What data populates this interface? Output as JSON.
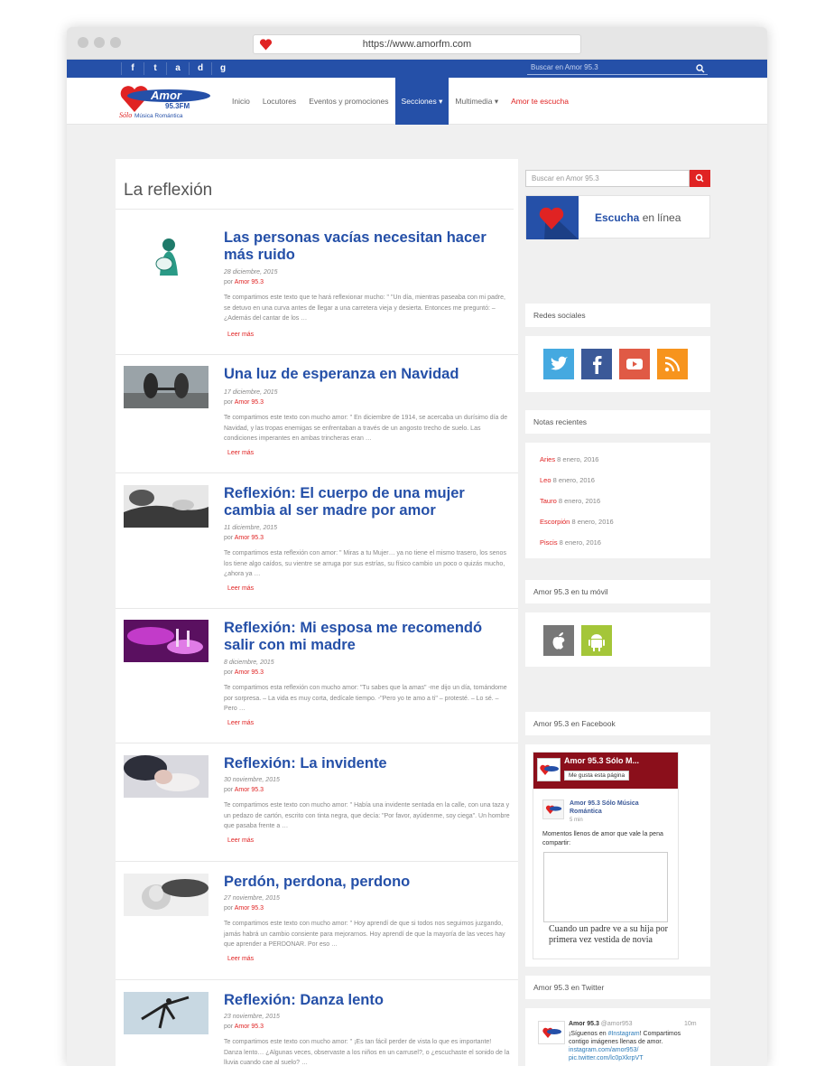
{
  "browser": {
    "url": "https://www.amorfm.com"
  },
  "topbar": {
    "social": [
      "f",
      "t",
      "a",
      "d",
      "g"
    ],
    "search_placeholder": "Buscar en Amor 95.3"
  },
  "header": {
    "logo_text": "Amor",
    "logo_freq": "95.3FM",
    "logo_tagline_1": "Sólo",
    "logo_tagline_2": "Música Romántica",
    "nav": [
      {
        "label": "Inicio"
      },
      {
        "label": "Locutores"
      },
      {
        "label": "Eventos y promociones"
      },
      {
        "label": "Secciones ▾"
      },
      {
        "label": "Multimedia ▾"
      },
      {
        "label": "Amor te escucha"
      }
    ]
  },
  "main": {
    "title": "La reflexión",
    "read_more": "Leer más",
    "by_label": "por",
    "posts": [
      {
        "title": "Las personas vacías necesitan hacer más ruido",
        "date": "28 diciembre, 2015",
        "author": "Amor 95.3",
        "excerpt": "Te compartimos este texto que te hará reflexionar mucho: \" \"Un día, mientras paseaba con mi padre, se detuvo en una curva antes de llegar a una carretera vieja y desierta. Entonces me preguntó: – ¿Además del cantar de los …"
      },
      {
        "title": "Una luz de esperanza en Navidad",
        "date": "17 diciembre, 2015",
        "author": "Amor 95.3",
        "excerpt": "Te compartimos este texto con mucho amor: \" En diciembre de 1914, se acercaba un durísimo día de Navidad, y las tropas enemigas se enfrentaban a través de un angosto trecho de suelo. Las condiciones imperantes en ambas trincheras eran …"
      },
      {
        "title": "Reflexión: El cuerpo de una mujer cambia al ser madre por amor",
        "date": "11 diciembre, 2015",
        "author": "Amor 95.3",
        "excerpt": "Te compartimos esta reflexión con amor: \" Miras a tu Mujer… ya no tiene el mismo trasero, los senos los tiene algo caídos, su vientre se arruga por sus estrías, su físico cambio un poco o quizás mucho, ¿ahora ya …"
      },
      {
        "title": "Reflexión: Mi esposa me recomendó salir con mi madre",
        "date": "8 diciembre, 2015",
        "author": "Amor 95.3",
        "excerpt": "Te compartimos esta reflexión con mucho amor: \"Tu sabes que la amas\" -me dijo un día, tomándome por sorpresa. – La vida es muy corta, dedícale tiempo. -\"Pero yo te amo a ti\" – protesté. – Lo sé. – Pero …"
      },
      {
        "title": "Reflexión: La invidente",
        "date": "30 noviembre, 2015",
        "author": "Amor 95.3",
        "excerpt": "Te compartimos este texto con mucho amor: \" Había una invidente sentada en la calle, con una taza y un pedazo de cartón, escrito con tinta negra, que decía: \"Por favor, ayúdenme, soy ciega\". Un hombre que pasaba frente a …"
      },
      {
        "title": "Perdón, perdona, perdono",
        "date": "27 noviembre, 2015",
        "author": "Amor 95.3",
        "excerpt": "Te compartimos este texto con mucho amor: \" Hoy aprendí de que si todos nos seguimos juzgando, jamás habrá un cambio consiente para mejorarnos. Hoy aprendí de que la mayoría de las veces hay que aprender a PERDONAR. Por eso …"
      },
      {
        "title": "Reflexión: Danza lento",
        "date": "23 noviembre, 2015",
        "author": "Amor 95.3",
        "excerpt": "Te compartimos este texto con mucho amor: \" ¡Es tan fácil perder de vista lo que es importante! Danza lento… ¿Algunas veces, observaste a los niños en un carrusel?, o ¿escuchaste el sonido de la lluvia cuando cae al suelo? …"
      }
    ]
  },
  "sidebar": {
    "search_placeholder": "Buscar en Amor 95.3",
    "listen_strong": "Escucha",
    "listen_rest": " en línea",
    "social_title": "Redes sociales",
    "recent_title": "Notas recientes",
    "recent": [
      {
        "name": "Aries",
        "date": " 8 enero, 2016"
      },
      {
        "name": "Leo",
        "date": " 8 enero, 2016"
      },
      {
        "name": "Tauro",
        "date": " 8 enero, 2016"
      },
      {
        "name": "Escorpión",
        "date": " 8 enero, 2016"
      },
      {
        "name": "Piscis",
        "date": " 8 enero, 2016"
      }
    ],
    "mobile_title": "Amor 95.3 en tu móvil",
    "facebook_title": "Amor 95.3 en Facebook",
    "fb": {
      "page_name": "Amor 95.3 Sólo M...",
      "like_label": "Me gusta esta página",
      "post_author": "Amor 95.3 Sólo Música Romántica",
      "post_time": "5 min",
      "post_text": "Momentos llenos de amor que vale la pena compartir:",
      "caption": "Cuando un padre ve a su hija por primera vez vestida de novia"
    },
    "twitter_title": "Amor 95.3 en Twitter",
    "tw": {
      "name": "Amor 95.3",
      "handle": " @amor953",
      "time": "10m",
      "text_1": "¡Síguenos en ",
      "text_link": "#Instagram",
      "text_2": "! Compartimos contigo imágenes llenas de amor. ",
      "text_link2": "instagram.com/amor953/",
      "text_link3": "pic.twitter.com/lc0pXkrpVT"
    }
  },
  "colors": {
    "brand_blue": "#2550a8",
    "accent_red": "#e02323"
  }
}
